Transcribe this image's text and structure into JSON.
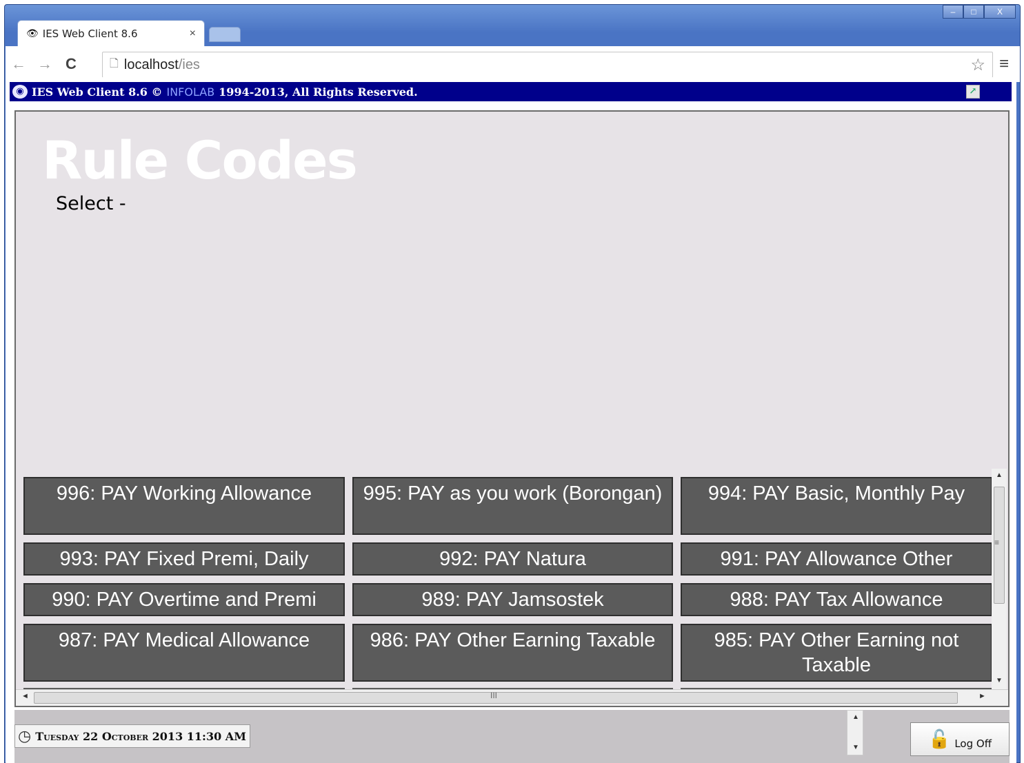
{
  "browser": {
    "tab_title": "IES Web Client 8.6",
    "tab_close": "×",
    "url_host": "localhost",
    "url_path": "/ies",
    "back_glyph": "←",
    "forward_glyph": "→",
    "reload_glyph": "C",
    "star_glyph": "☆",
    "menu_glyph": "≡",
    "window_controls": {
      "minimize": "–",
      "maximize": "□",
      "close": "X"
    }
  },
  "app_header": {
    "title": "IES Web Client 8.6 ©",
    "brand": "INFOLAB",
    "rights": "1994-2013, All Rights Reserved."
  },
  "page": {
    "title": "Rule Codes",
    "select_label": "Select -"
  },
  "rule_codes": [
    {
      "label": "996: PAY Working Allowance"
    },
    {
      "label": "995: PAY as you work (Borongan)"
    },
    {
      "label": "994: PAY Basic, Monthly Pay"
    },
    {
      "label": "993: PAY Fixed Premi, Daily"
    },
    {
      "label": "992: PAY Natura"
    },
    {
      "label": "991: PAY Allowance Other"
    },
    {
      "label": "990: PAY Overtime and Premi"
    },
    {
      "label": "989: PAY Jamsostek"
    },
    {
      "label": "988: PAY Tax Allowance"
    },
    {
      "label": "987: PAY Medical Allowance"
    },
    {
      "label": "986: PAY Other Earning Taxable"
    },
    {
      "label": "985: PAY Other Earning not Taxable"
    }
  ],
  "scroll": {
    "grip_v": "≡",
    "grip_h": "III",
    "up": "▲",
    "down": "▼",
    "left": "◄",
    "right": "►"
  },
  "status_bar": {
    "datetime": "Tuesday 22 October 2013 11:30 AM",
    "logoff_label": "Log Off"
  },
  "icons": {
    "favicon": "eye-icon",
    "page": "page-icon",
    "clock": "clock-icon",
    "lock": "lock-icon",
    "export": "export-icon"
  },
  "colors": {
    "header_bg": "#00008b",
    "panel_bg": "#e7e3e7",
    "button_bg": "#5b5b5b",
    "title_color": "#ffffff"
  }
}
